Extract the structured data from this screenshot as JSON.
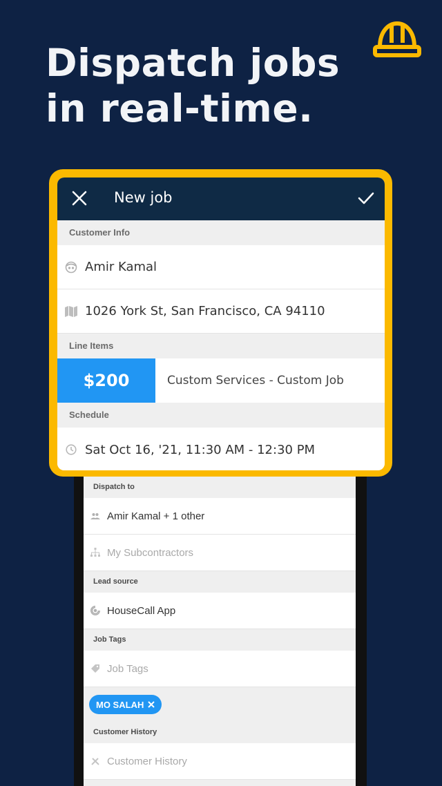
{
  "headline": {
    "line1": "Dispatch jobs",
    "line2": "in real-time."
  },
  "icons": {
    "brand": "hard-hat-icon",
    "accent_color": "#fbb900"
  },
  "card": {
    "title": "New job",
    "sections": {
      "customer_info": "Customer Info",
      "line_items": "Line Items",
      "schedule": "Schedule"
    },
    "customer_name": "Amir Kamal",
    "address": "1026 York St, San Francisco, CA 94110",
    "line_item": {
      "price": "$200",
      "description": "Custom Services - Custom Job"
    },
    "schedule_time": "Sat Oct 16, '21, 11:30 AM - 12:30 PM"
  },
  "phone": {
    "dispatch_to_label": "Dispatch to",
    "dispatch_value": "Amir Kamal + 1 other",
    "subcontractors_placeholder": "My Subcontractors",
    "lead_source_label": "Lead source",
    "lead_source_value": "HouseCall App",
    "job_tags_label": "Job Tags",
    "job_tags_placeholder": "Job Tags",
    "tag_chip": "MO SALAH",
    "customer_history_label": "Customer History",
    "customer_history_value": "Customer History"
  }
}
